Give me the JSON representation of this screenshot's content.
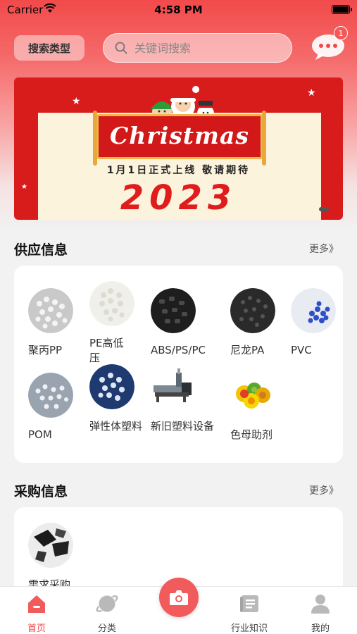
{
  "status": {
    "carrier": "Carrier",
    "time": "4:58 PM"
  },
  "header": {
    "search_type_label": "搜索类型",
    "search_placeholder": "关键词搜索",
    "message_badge": "1"
  },
  "banner": {
    "title": "Christmas",
    "subtitle": "1月1日正式上线  敬请期待",
    "year": "2023"
  },
  "supply": {
    "title": "供应信息",
    "more": "更多》",
    "items": [
      {
        "label": "聚丙PP",
        "icon": "pp-pellets"
      },
      {
        "label": "PE高低压",
        "icon": "pe-pellets"
      },
      {
        "label": "ABS/PS/PC",
        "icon": "abs-pellets"
      },
      {
        "label": "尼龙PA",
        "icon": "nylon-pellets"
      },
      {
        "label": "PVC",
        "icon": "pvc-pellets"
      },
      {
        "label": "POM",
        "icon": "pom-pellets"
      },
      {
        "label": "弹性体塑料",
        "icon": "elastomer-pellets"
      },
      {
        "label": "新旧塑料设备",
        "icon": "extruder-machine"
      },
      {
        "label": "色母助剂",
        "icon": "masterbatch-pellets"
      }
    ]
  },
  "purchase": {
    "title": "采购信息",
    "more": "更多》",
    "items": [
      {
        "label": "需求采购",
        "icon": "purchase-pellets"
      }
    ]
  },
  "tabs": [
    {
      "label": "首页",
      "icon": "home-icon",
      "active": true
    },
    {
      "label": "分类",
      "icon": "category-icon",
      "active": false
    },
    {
      "label": "",
      "icon": "camera-icon",
      "active": false
    },
    {
      "label": "行业知识",
      "icon": "book-icon",
      "active": false
    },
    {
      "label": "我的",
      "icon": "profile-icon",
      "active": false
    }
  ],
  "colors": {
    "primary": "#f04848",
    "banner_red": "#d81c1c",
    "pvc_blue": "#2f4fc8"
  }
}
